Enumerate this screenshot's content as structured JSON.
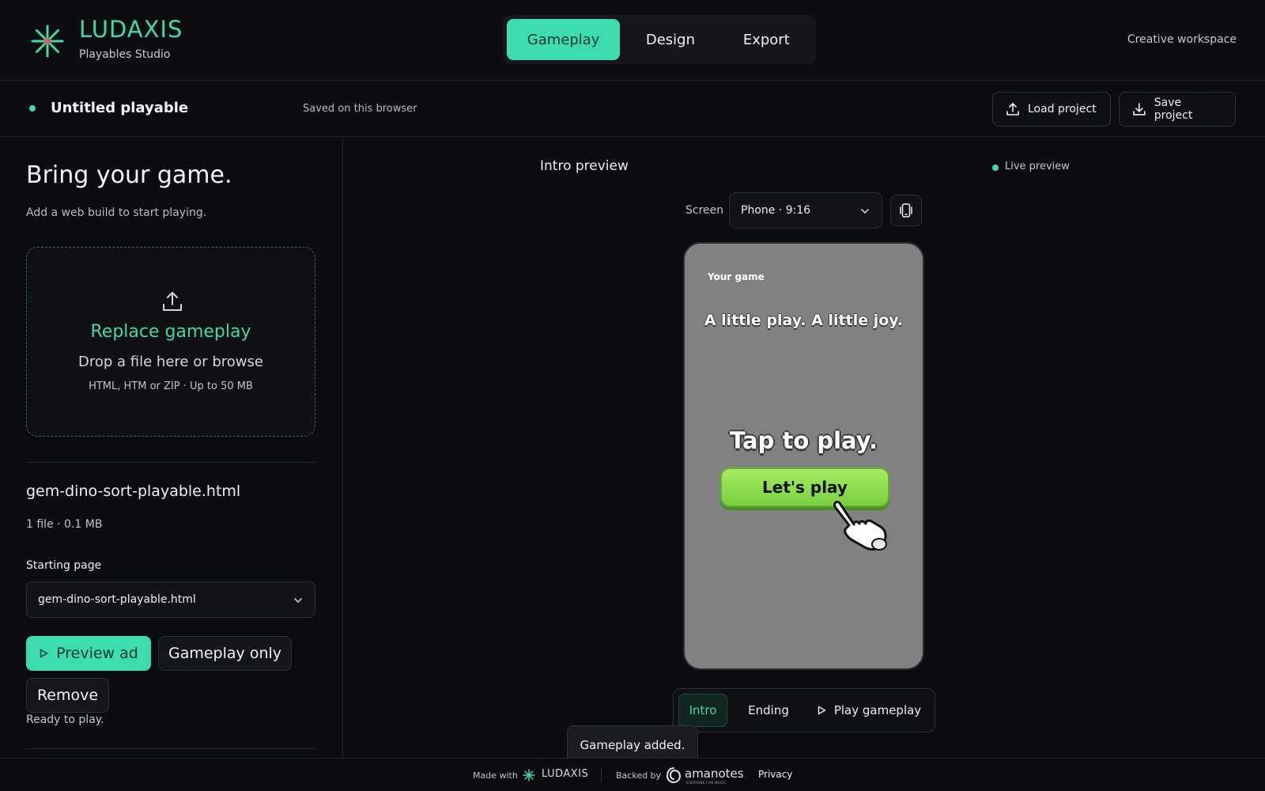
{
  "brand": {
    "name": "LUDAXIS",
    "subtitle": "Playables Studio",
    "accent": "#3ddcae"
  },
  "nav": {
    "tabs": [
      {
        "label": "Gameplay",
        "active": true
      },
      {
        "label": "Design"
      },
      {
        "label": "Export"
      }
    ]
  },
  "workspace_label": "Creative workspace",
  "project": {
    "name": "Untitled playable",
    "saved_status": "Saved on this browser",
    "load_label": "Load project",
    "save_label": "Save project"
  },
  "sidebar": {
    "title": "Bring your game.",
    "subtitle": "Add a web build to start playing.",
    "dropzone": {
      "title": "Replace gameplay",
      "text": "Drop a file here or browse",
      "hint": "HTML, HTM or ZIP · Up to 50 MB"
    },
    "file": {
      "name": "gem-dino-sort-playable.html",
      "meta": "1 file · 0.1 MB"
    },
    "starting_page": {
      "label": "Starting page",
      "value": "gem-dino-sort-playable.html"
    },
    "actions": {
      "preview": "Preview ad",
      "gameplay_only": "Gameplay only",
      "remove": "Remove"
    },
    "status": "Ready to play."
  },
  "preview": {
    "title": "Intro preview",
    "live_label": "Live preview",
    "screen_label": "Screen",
    "screen_value": "Phone · 9:16",
    "phone": {
      "game_label": "Your game",
      "tagline": "A little play. A little joy.",
      "tap_text": "Tap to play.",
      "cta_label": "Let's play"
    },
    "modes": [
      {
        "label": "Intro",
        "active": true
      },
      {
        "label": "Ending"
      },
      {
        "label": "Play gameplay"
      }
    ]
  },
  "toast": "Gameplay added.",
  "footer": {
    "made_with": "Made with",
    "brand": "LUDAXIS",
    "backed_by": "Backed by",
    "partner": "amanotes",
    "partner_tagline": "EVERYONE CAN MUSIC",
    "privacy": "Privacy"
  }
}
